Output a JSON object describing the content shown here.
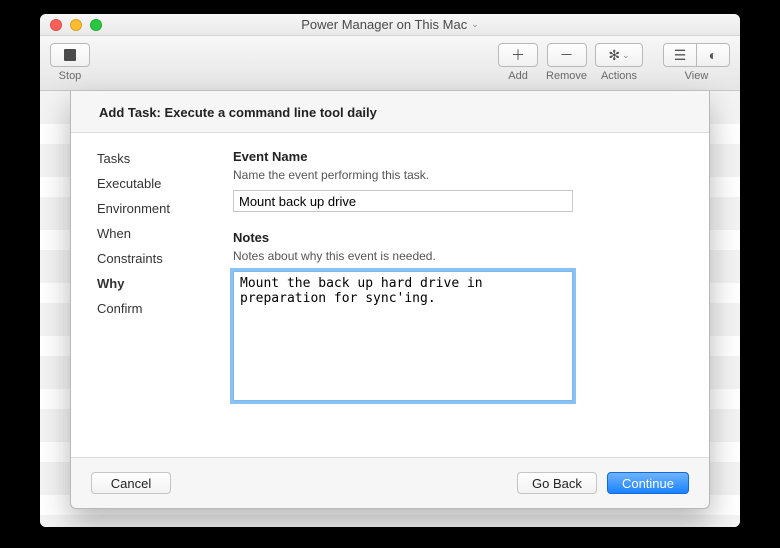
{
  "window": {
    "title": "Power Manager on This Mac"
  },
  "toolbar": {
    "stop": "Stop",
    "add": "Add",
    "remove": "Remove",
    "actions": "Actions",
    "view": "View"
  },
  "sheet": {
    "header": "Add Task: Execute a command line tool daily",
    "steps": [
      {
        "label": "Tasks",
        "active": false
      },
      {
        "label": "Executable",
        "active": false
      },
      {
        "label": "Environment",
        "active": false
      },
      {
        "label": "When",
        "active": false
      },
      {
        "label": "Constraints",
        "active": false
      },
      {
        "label": "Why",
        "active": true
      },
      {
        "label": "Confirm",
        "active": false
      }
    ],
    "event_name": {
      "title": "Event Name",
      "desc": "Name the event performing this task.",
      "value": "Mount back up drive"
    },
    "notes": {
      "title": "Notes",
      "desc": "Notes about why this event is needed.",
      "value": "Mount the back up hard drive in preparation for sync'ing."
    },
    "buttons": {
      "cancel": "Cancel",
      "goback": "Go Back",
      "continue": "Continue"
    }
  }
}
